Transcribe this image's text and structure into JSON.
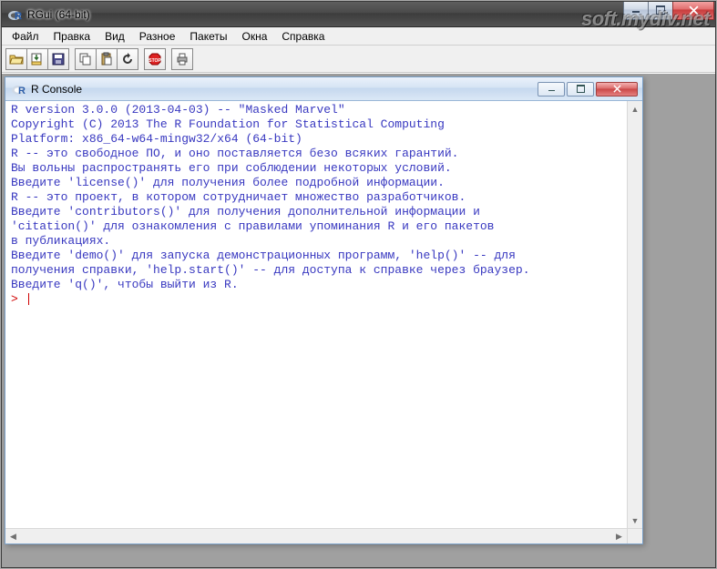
{
  "outer": {
    "title": "RGui (64-bit)"
  },
  "menu": {
    "items": [
      "Файл",
      "Правка",
      "Вид",
      "Разное",
      "Пакеты",
      "Окна",
      "Справка"
    ]
  },
  "toolbar": {
    "icons": [
      "open",
      "load-ws",
      "save",
      "copy",
      "paste",
      "refresh",
      "stop",
      "print"
    ]
  },
  "console": {
    "title": "R Console",
    "lines": [
      "",
      "R version 3.0.0 (2013-04-03) -- \"Masked Marvel\"",
      "Copyright (C) 2013 The R Foundation for Statistical Computing",
      "Platform: x86_64-w64-mingw32/x64 (64-bit)",
      "",
      "R -- это свободное ПО, и оно поставляется безо всяких гарантий.",
      "Вы вольны распространять его при соблюдении некоторых условий.",
      "Введите 'license()' для получения более подробной информации.",
      "",
      "R -- это проект, в котором сотрудничает множество разработчиков.",
      "Введите 'contributors()' для получения дополнительной информации и",
      "'citation()' для ознакомления с правилами упоминания R и его пакетов",
      "в публикациях.",
      "",
      "Введите 'demo()' для запуска демонстрационных программ, 'help()' -- для",
      "получения справки, 'help.start()' -- для доступа к справке через браузер.",
      "Введите 'q()', чтобы выйти из R.",
      ""
    ],
    "prompt": "> "
  },
  "watermark": "soft.mydiv.net"
}
